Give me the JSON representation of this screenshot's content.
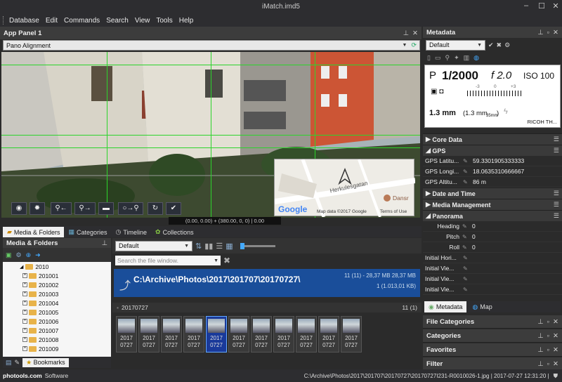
{
  "window": {
    "title": "iMatch.imd5"
  },
  "menu": [
    "Database",
    "Edit",
    "Commands",
    "Search",
    "View",
    "Tools",
    "Help"
  ],
  "app_panel": {
    "title": "App Panel 1",
    "selector": "Pano Alignment",
    "coords": "(0.00, 0.00) + (380.00, 0, 0) | 0.00",
    "map": {
      "street": "Herkulesgatan",
      "poi": "Dansr",
      "logo": "Google",
      "copyright": "Map data ©2017 Google",
      "terms": "Terms of Use"
    }
  },
  "bottom_tabs": [
    "Media & Folders",
    "Categories",
    "Timeline",
    "Collections"
  ],
  "media_folders": {
    "title": "Media & Folders",
    "root": "2010",
    "folders": [
      "201001",
      "201002",
      "201003",
      "201004",
      "201005",
      "201006",
      "201007",
      "201008",
      "201009"
    ],
    "bottom_tab": "Bookmarks"
  },
  "file_window": {
    "layout": "Default",
    "search_placeholder": "Search the file window.",
    "folder_path": "C:\\Archive\\Photos\\2017\\201707\\20170727\\",
    "folder_count": "11 (11) - 28,37 MB 28,37 MB",
    "folder_count2": "1 (1.013,01 KB)",
    "group": "20170727",
    "group_count": "11 (1)",
    "thumb_label_top": "2017",
    "thumb_label_bottom": "0727",
    "thumb_count": 11
  },
  "metadata": {
    "title": "Metadata",
    "preset": "Default",
    "camera": {
      "mode": "P",
      "shutter": "1/2000",
      "fnum": "f 2.0",
      "iso": "ISO 100",
      "scale_minus": "-3",
      "scale_zero": "0",
      "scale_plus": "+3",
      "focal": "1.3 mm",
      "focal2": "(1.3 mm",
      "focal_sub": "35mm",
      "focal_close": ")",
      "model": "RICOH TH..."
    },
    "sections": [
      "Core Data",
      "GPS",
      "Date and Time",
      "Media Management",
      "Panorama"
    ],
    "gps": [
      {
        "k": "GPS Latitu...",
        "v": "59.3301905333333"
      },
      {
        "k": "GPS Longi...",
        "v": "18.0635310666667"
      },
      {
        "k": "GPS Altitu...",
        "v": "86 m"
      }
    ],
    "panorama": [
      {
        "k": "Heading",
        "v": "0"
      },
      {
        "k": "Pitch",
        "v": "0"
      },
      {
        "k": "Roll",
        "v": "0"
      },
      {
        "k": "Initial Hori...",
        "v": ""
      },
      {
        "k": "Initial Vie...",
        "v": ""
      },
      {
        "k": "Initial Vie...",
        "v": ""
      },
      {
        "k": "Initial Vie...",
        "v": ""
      }
    ],
    "tabs": [
      "Metadata",
      "Map"
    ]
  },
  "right_panels": [
    "File Categories",
    "Categories",
    "Favorites",
    "Filter"
  ],
  "status": {
    "brand": "photools.com",
    "brand2": "Software",
    "path": "C:\\Archive\\Photos\\2017\\201707\\20170727\\20170727I231-R0010026-1.jpg | 2017-07-27 12:31:20 |"
  }
}
